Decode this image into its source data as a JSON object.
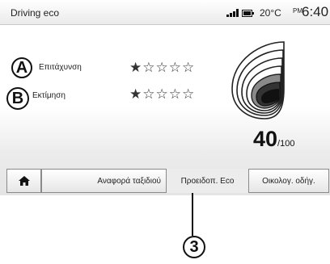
{
  "status_bar": {
    "title": "Driving eco",
    "signal_icon": "signal-bars-icon",
    "battery_icon": "battery-icon",
    "temperature": "20°C",
    "ampm": "PM",
    "time": "6:40"
  },
  "rows": [
    {
      "marker": "A",
      "label": "Επιτάχυνση",
      "stars": "★☆☆☆☆"
    },
    {
      "marker": "B",
      "label": "Εκτίμηση",
      "stars": "★☆☆☆☆"
    }
  ],
  "eco_score": {
    "value": "40",
    "denominator": "/100",
    "icon": "eco-leaf-icon"
  },
  "tabs": {
    "home_icon": "home-icon",
    "items": [
      "Αναφορά ταξιδιού",
      "Προειδοπ. Eco",
      "Οικολογ. οδήγ."
    ],
    "active_index": 1
  },
  "callout": "3"
}
